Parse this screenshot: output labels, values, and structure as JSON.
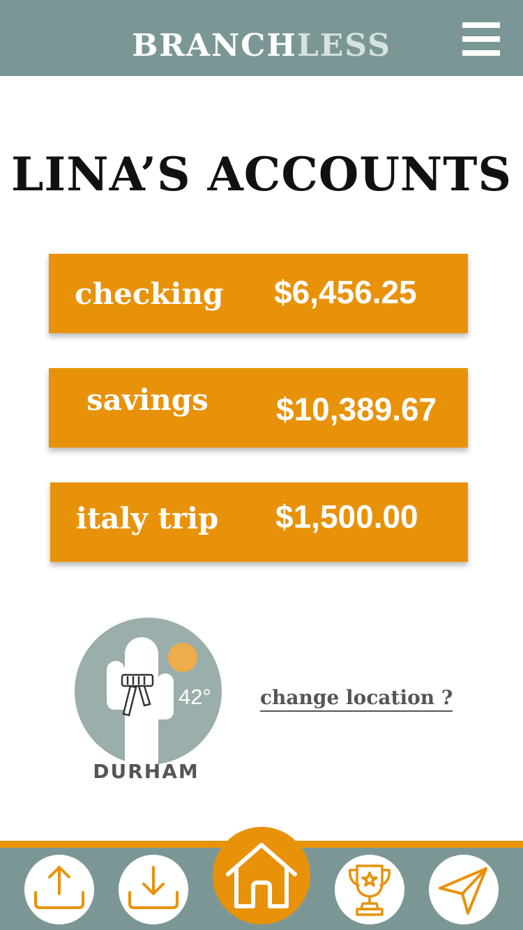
{
  "header": {
    "brand_part1": "BRANCH",
    "brand_part2": "LESS",
    "menu_icon": "hamburger-menu-icon"
  },
  "page": {
    "title": "LINA’S ACCOUNTS"
  },
  "accounts": [
    {
      "name": "checking",
      "balance": "$6,456.25"
    },
    {
      "name": "savings",
      "balance": "$10,389.67"
    },
    {
      "name": "italy trip",
      "balance": "$1,500.00"
    }
  ],
  "location": {
    "city": "DURHAM",
    "temperature": "42°",
    "weather_icon": "cactus-with-scarf-and-sun-icon",
    "change_link": "change location ?"
  },
  "nav": {
    "items": [
      {
        "icon": "upload-icon"
      },
      {
        "icon": "download-icon"
      },
      {
        "icon": "home-icon"
      },
      {
        "icon": "trophy-icon"
      },
      {
        "icon": "send-icon"
      }
    ]
  },
  "colors": {
    "header_bg": "#7b9795",
    "accent_orange": "#e8920a",
    "weather_circle": "#9aaeab",
    "text_dark": "#111111",
    "text_gray": "#555555"
  }
}
